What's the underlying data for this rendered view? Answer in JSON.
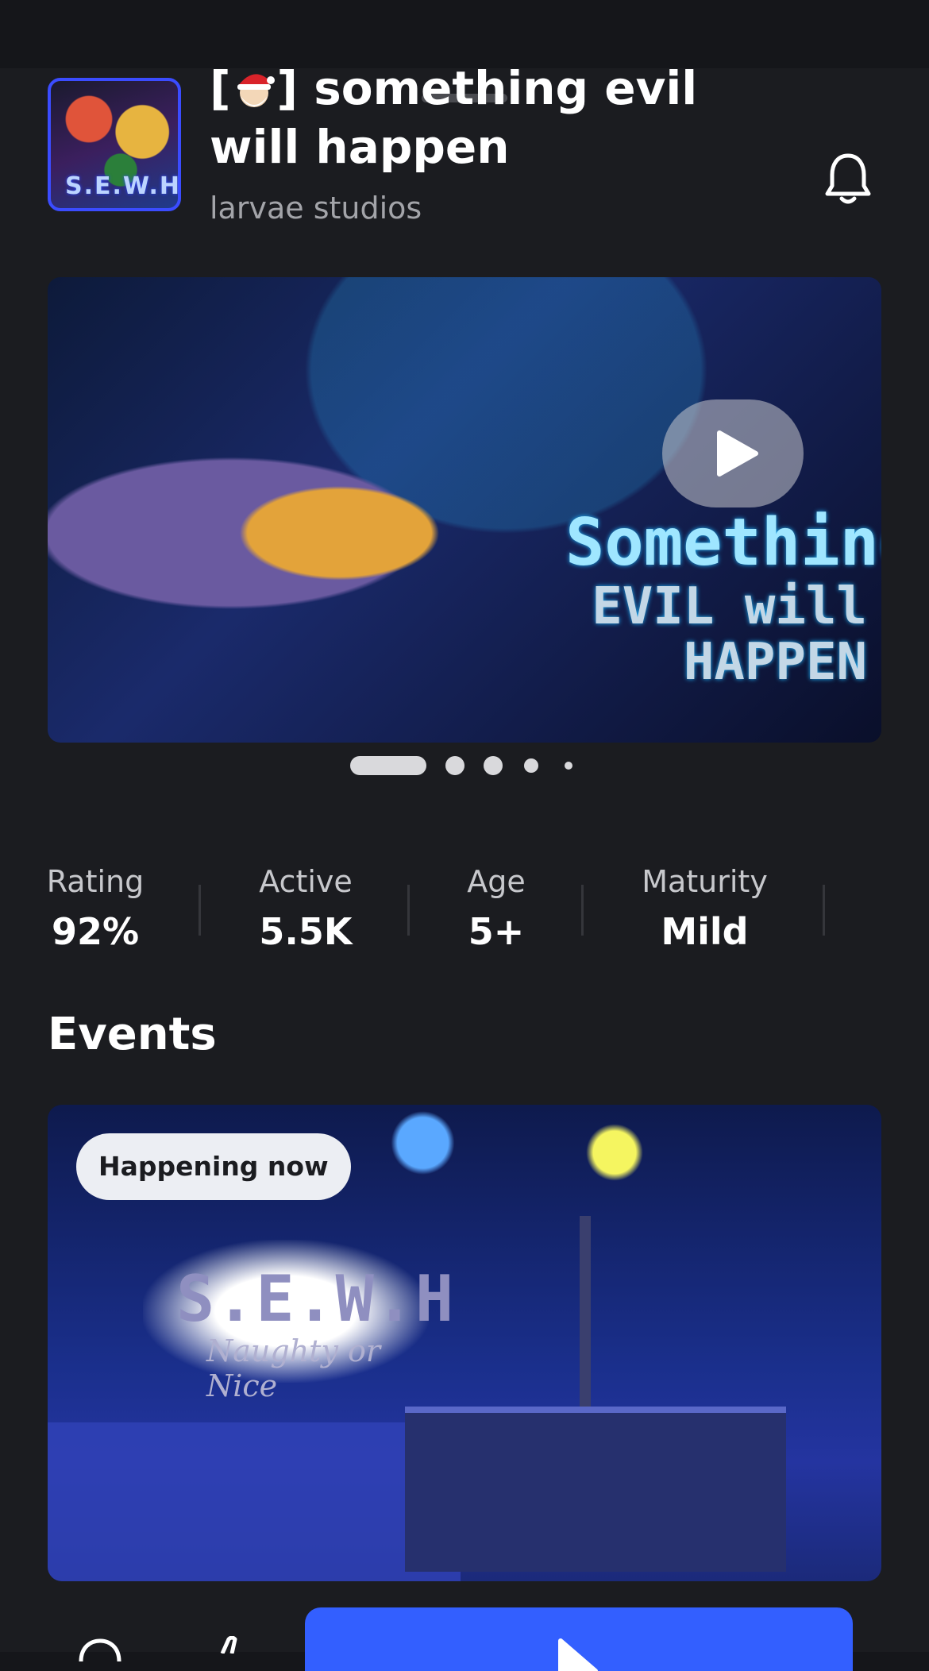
{
  "game": {
    "title_prefix": "[",
    "title_suffix": "] something evil will happen",
    "developer": "larvae studios",
    "icon_text": "S.E.W.H"
  },
  "media": {
    "logo_line1": "Something",
    "logo_line2": "EVIL will",
    "logo_line3": "HAPPEN"
  },
  "stats": [
    {
      "label": "Rating",
      "value": "92%"
    },
    {
      "label": "Active",
      "value": "5.5K"
    },
    {
      "label": "Age",
      "value": "5+"
    },
    {
      "label": "Maturity",
      "value": "Mild"
    }
  ],
  "events": {
    "section_title": "Events",
    "badge": "Happening now",
    "logo_line1": "S.E.W.H",
    "logo_line2": "Naughty or Nice"
  },
  "colors": {
    "background": "#1b1c20",
    "accent": "#335fff",
    "badge_bg": "#eceef3"
  },
  "icons": [
    "bell-icon",
    "play-icon",
    "santa-emoji",
    "comment-icon",
    "thumb-icon"
  ]
}
